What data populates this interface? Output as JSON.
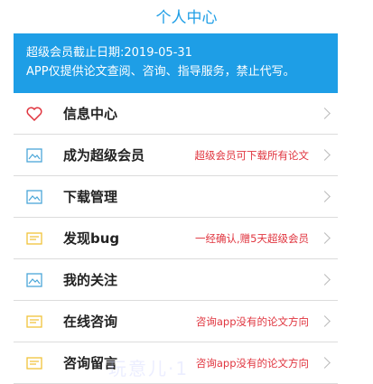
{
  "header": {
    "title": "个人中心"
  },
  "banner": {
    "line1": "超级会员截止日期:2019-05-31",
    "line2": "APP仅提供论文查阅、咨询、指导服务，禁止代写。"
  },
  "menu": [
    {
      "label": "信息中心",
      "note": "",
      "icon": "heart-icon"
    },
    {
      "label": "成为超级会员",
      "note": "超级会员可下载所有论文",
      "icon": "image-icon"
    },
    {
      "label": "下载管理",
      "note": "",
      "icon": "image-icon"
    },
    {
      "label": "发现bug",
      "note": "一经确认,赠5天超级会员",
      "icon": "message-icon"
    },
    {
      "label": "我的关注",
      "note": "",
      "icon": "image-icon"
    },
    {
      "label": "在线咨询",
      "note": "咨询app没有的论文方向",
      "icon": "message-icon"
    },
    {
      "label": "咨询留言",
      "note": "咨询app没有的论文方向",
      "icon": "message-icon"
    }
  ],
  "watermark": "玩意儿·1",
  "colors": {
    "accent": "#1e9ee6",
    "note": "#e0353f",
    "msg_icon": "#f0c23a",
    "img_icon": "#4aa6d8",
    "heart": "#e0353f"
  }
}
